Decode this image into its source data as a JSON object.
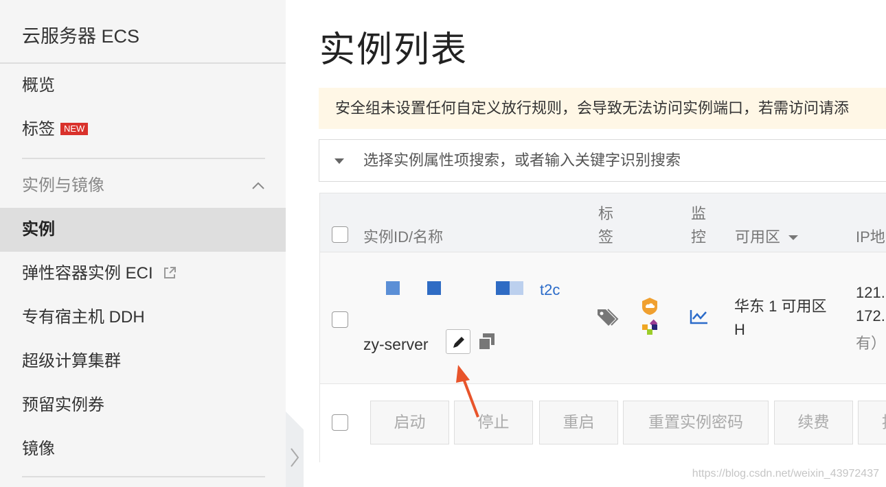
{
  "sidebar": {
    "title": "云服务器 ECS",
    "items": {
      "overview": "概览",
      "tags": "标签",
      "tags_badge": "NEW",
      "group_instances": "实例与镜像",
      "instances": "实例",
      "eci": "弹性容器实例 ECI",
      "ddh": "专有宿主机 DDH",
      "super_compute": "超级计算集群",
      "reserved": "预留实例券",
      "images": "镜像"
    }
  },
  "main": {
    "title": "实例列表",
    "notice": "安全组未设置任何自定义放行规则，会导致无法访问实例端口，若需访问请添",
    "search_placeholder": "选择实例属性项搜索，或者输入关键字识别搜索",
    "table": {
      "headers": {
        "id_name": "实例ID/名称",
        "tag_1": "标",
        "tag_2": "签",
        "monitor_1": "监",
        "monitor_2": "控",
        "zone": "可用区",
        "ip": "IP地"
      },
      "rows": [
        {
          "id_suffix": "t2c",
          "name": "zy-server",
          "zone_line1": "华东 1 可用区",
          "zone_line2": "H",
          "ip_line1": "121.",
          "ip_line2": "172.",
          "ip_line3": "有）"
        }
      ]
    },
    "batch_buttons": {
      "start": "启动",
      "stop": "停止",
      "restart": "重启",
      "reset_password": "重置实例密码",
      "renew": "续费",
      "more": "按"
    }
  },
  "watermark": "https://blog.csdn.net/weixin_43972437",
  "colors": {
    "link": "#2b6bc9",
    "badge": "#d9322c",
    "notice_bg": "#fff7e6",
    "arrow": "#e8542b",
    "os_icon": "#f0a030"
  },
  "icons": [
    "chevron-up-icon",
    "external-link-icon",
    "chevron-right-icon",
    "caret-down-icon",
    "edit-icon",
    "copy-icon",
    "tag-icon",
    "alibaba-os-icon",
    "centos-icon",
    "monitor-chart-icon",
    "sort-caret-icon",
    "annotation-arrow"
  ]
}
